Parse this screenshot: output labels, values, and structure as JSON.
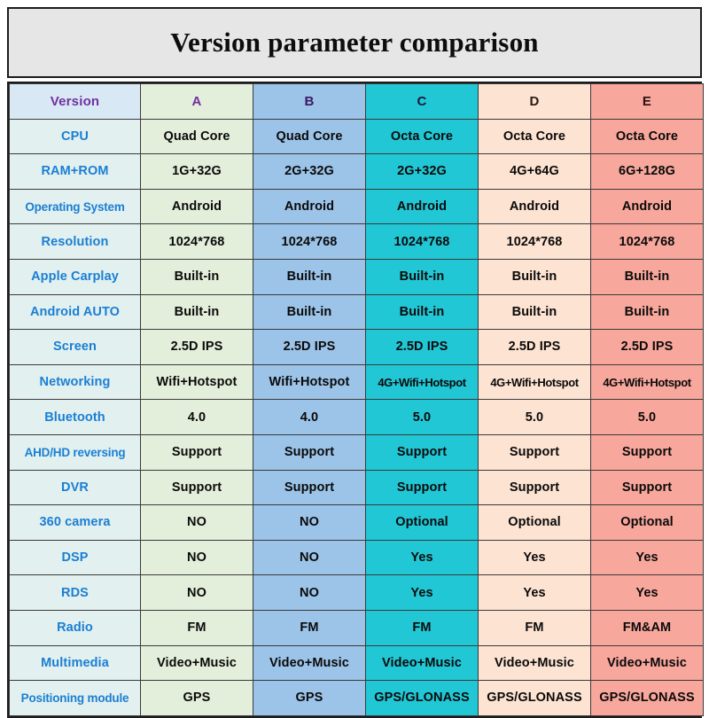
{
  "title": "Version parameter comparison",
  "colors": {
    "title_bar_bg": "#e6e6e6",
    "border": "#1c1c1c",
    "header_version_bg": "#d9e8f5",
    "header_version_text": "#7030a0",
    "label_bg": "#e2f0ef",
    "label_text": "#1a7fd4",
    "col_a": "#e4efdb",
    "col_b": "#9cc3e8",
    "col_c": "#22c7d6",
    "col_d": "#fde3d2",
    "col_e": "#f8a79c"
  },
  "table": {
    "headers": [
      "Version",
      "A",
      "B",
      "C",
      "D",
      "E"
    ],
    "rows": [
      {
        "label": "CPU",
        "values": [
          "Quad Core",
          "Quad Core",
          "Octa Core",
          "Octa Core",
          "Octa Core"
        ]
      },
      {
        "label": "RAM+ROM",
        "values": [
          "1G+32G",
          "2G+32G",
          "2G+32G",
          "4G+64G",
          "6G+128G"
        ]
      },
      {
        "label": "Operating System",
        "values": [
          "Android",
          "Android",
          "Android",
          "Android",
          "Android"
        ]
      },
      {
        "label": "Resolution",
        "values": [
          "1024*768",
          "1024*768",
          "1024*768",
          "1024*768",
          "1024*768"
        ]
      },
      {
        "label": "Apple Carplay",
        "values": [
          "Built-in",
          "Built-in",
          "Built-in",
          "Built-in",
          "Built-in"
        ]
      },
      {
        "label": "Android AUTO",
        "values": [
          "Built-in",
          "Built-in",
          "Built-in",
          "Built-in",
          "Built-in"
        ]
      },
      {
        "label": "Screen",
        "values": [
          "2.5D IPS",
          "2.5D IPS",
          "2.5D IPS",
          "2.5D IPS",
          "2.5D IPS"
        ]
      },
      {
        "label": "Networking",
        "values": [
          "Wifi+Hotspot",
          "Wifi+Hotspot",
          "4G+Wifi+Hotspot",
          "4G+Wifi+Hotspot",
          "4G+Wifi+Hotspot"
        ]
      },
      {
        "label": "Bluetooth",
        "values": [
          "4.0",
          "4.0",
          "5.0",
          "5.0",
          "5.0"
        ]
      },
      {
        "label": "AHD/HD reversing",
        "values": [
          "Support",
          "Support",
          "Support",
          "Support",
          "Support"
        ]
      },
      {
        "label": "DVR",
        "values": [
          "Support",
          "Support",
          "Support",
          "Support",
          "Support"
        ]
      },
      {
        "label": "360 camera",
        "values": [
          "NO",
          "NO",
          "Optional",
          "Optional",
          "Optional"
        ]
      },
      {
        "label": "DSP",
        "values": [
          "NO",
          "NO",
          "Yes",
          "Yes",
          "Yes"
        ]
      },
      {
        "label": "RDS",
        "values": [
          "NO",
          "NO",
          "Yes",
          "Yes",
          "Yes"
        ]
      },
      {
        "label": "Radio",
        "values": [
          "FM",
          "FM",
          "FM",
          "FM",
          "FM&AM"
        ]
      },
      {
        "label": "Multimedia",
        "values": [
          "Video+Music",
          "Video+Music",
          "Video+Music",
          "Video+Music",
          "Video+Music"
        ]
      },
      {
        "label": "Positioning module",
        "values": [
          "GPS",
          "GPS",
          "GPS/GLONASS",
          "GPS/GLONASS",
          "GPS/GLONASS"
        ]
      }
    ]
  }
}
